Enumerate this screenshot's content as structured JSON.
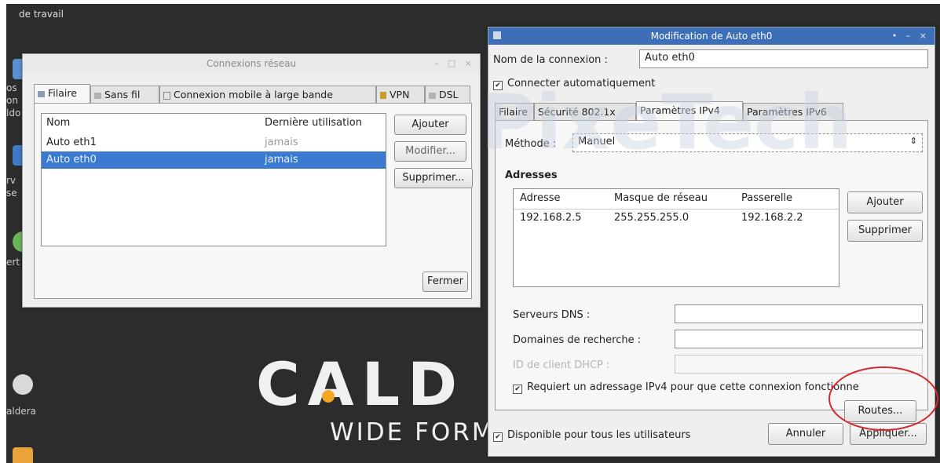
{
  "desktop": {
    "top_label": "de travail",
    "icon_labels": [
      "os",
      "on",
      "ldo",
      "rv",
      "se",
      "ert",
      "aldera"
    ],
    "brand_name": "CALD",
    "brand_sub": "WIDE FORM"
  },
  "network_window": {
    "title": "Connexions réseau",
    "tabs": [
      "Filaire",
      "Sans fil",
      "Connexion mobile à large bande",
      "VPN",
      "DSL"
    ],
    "columns": [
      "Nom",
      "Dernière utilisation"
    ],
    "rows": [
      {
        "name": "Auto eth1",
        "last_used": "jamais",
        "selected": false
      },
      {
        "name": "Auto eth0",
        "last_used": "jamais",
        "selected": true
      }
    ],
    "buttons": {
      "add": "Ajouter",
      "edit": "Modifier...",
      "delete": "Supprimer...",
      "close": "Fermer"
    }
  },
  "edit_window": {
    "title": "Modification de Auto eth0",
    "connection_name_label": "Nom de la connexion :",
    "connection_name_value": "Auto eth0",
    "auto_connect_label": "Connecter automatiquement",
    "auto_connect_checked": true,
    "tabs": [
      "Filaire",
      "Sécurité 802.1x",
      "Paramètres IPv4",
      "Paramètres IPv6"
    ],
    "active_tab": "Paramètres IPv4",
    "method_label": "Méthode :",
    "method_value": "Manuel",
    "addresses_heading": "Adresses",
    "address_columns": [
      "Adresse",
      "Masque de réseau",
      "Passerelle"
    ],
    "addresses": [
      {
        "address": "192.168.2.5",
        "netmask": "255.255.255.0",
        "gateway": "192.168.2.2"
      }
    ],
    "address_buttons": {
      "add": "Ajouter",
      "delete": "Supprimer"
    },
    "dns_label": "Serveurs DNS :",
    "dns_value": "",
    "search_domains_label": "Domaines de recherche :",
    "search_domains_value": "",
    "dhcp_client_id_label": "ID de client DHCP :",
    "dhcp_client_id_value": "",
    "require_ipv4_label": "Requiert un adressage IPv4 pour que cette connexion fonctionne",
    "require_ipv4_checked": true,
    "routes_button": "Routes...",
    "all_users_label": "Disponible pour tous les utilisateurs",
    "all_users_checked": true,
    "cancel_button": "Annuler",
    "apply_button": "Appliquer..."
  },
  "colors": {
    "selection": "#3b7bcf",
    "titlebar_active": "#3d6fb8",
    "annotation_circle": "#d8262c",
    "brand_accent": "#f5a623"
  }
}
